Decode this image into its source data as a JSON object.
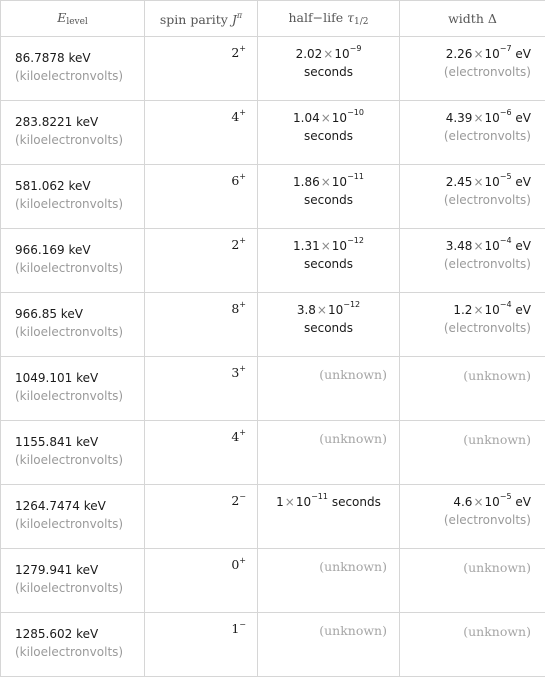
{
  "header": {
    "col1": {
      "symbol": "E",
      "subscript": "level"
    },
    "col2": {
      "label": "spin parity ",
      "symbol": "J",
      "superscript": "π"
    },
    "col3": {
      "label": "half−life ",
      "symbol": "τ",
      "subscript": "1/2"
    },
    "col4": {
      "label": "width Δ"
    }
  },
  "rows": [
    {
      "energy": "86.7878 keV",
      "energy_unit": "(kiloelectronvolts)",
      "spin": "2",
      "parity": "+",
      "halflife": {
        "mantissa": "2.02",
        "exp": "−9",
        "unit": "seconds",
        "inline": false
      },
      "width": {
        "mantissa": "2.26",
        "exp": "−7",
        "unit": "eV",
        "unit_long": "(electronvolts)"
      }
    },
    {
      "energy": "283.8221 keV",
      "energy_unit": "(kiloelectronvolts)",
      "spin": "4",
      "parity": "+",
      "halflife": {
        "mantissa": "1.04",
        "exp": "−10",
        "unit": "seconds",
        "inline": false
      },
      "width": {
        "mantissa": "4.39",
        "exp": "−6",
        "unit": "eV",
        "unit_long": "(electronvolts)"
      }
    },
    {
      "energy": "581.062 keV",
      "energy_unit": "(kiloelectronvolts)",
      "spin": "6",
      "parity": "+",
      "halflife": {
        "mantissa": "1.86",
        "exp": "−11",
        "unit": "seconds",
        "inline": false
      },
      "width": {
        "mantissa": "2.45",
        "exp": "−5",
        "unit": "eV",
        "unit_long": "(electronvolts)"
      }
    },
    {
      "energy": "966.169 keV",
      "energy_unit": "(kiloelectronvolts)",
      "spin": "2",
      "parity": "+",
      "halflife": {
        "mantissa": "1.31",
        "exp": "−12",
        "unit": "seconds",
        "inline": false
      },
      "width": {
        "mantissa": "3.48",
        "exp": "−4",
        "unit": "eV",
        "unit_long": "(electronvolts)"
      }
    },
    {
      "energy": "966.85 keV",
      "energy_unit": "(kiloelectronvolts)",
      "spin": "8",
      "parity": "+",
      "halflife": {
        "mantissa": "3.8",
        "exp": "−12",
        "unit": "seconds",
        "inline": false
      },
      "width": {
        "mantissa": "1.2",
        "exp": "−4",
        "unit": "eV",
        "unit_long": "(electronvolts)"
      }
    },
    {
      "energy": "1049.101 keV",
      "energy_unit": "(kiloelectronvolts)",
      "spin": "3",
      "parity": "+",
      "halflife": null,
      "width": null
    },
    {
      "energy": "1155.841 keV",
      "energy_unit": "(kiloelectronvolts)",
      "spin": "4",
      "parity": "+",
      "halflife": null,
      "width": null
    },
    {
      "energy": "1264.7474 keV",
      "energy_unit": "(kiloelectronvolts)",
      "spin": "2",
      "parity": "−",
      "halflife": {
        "mantissa": "1",
        "exp": "−11",
        "unit": "seconds",
        "inline": true
      },
      "width": {
        "mantissa": "4.6",
        "exp": "−5",
        "unit": "eV",
        "unit_long": "(electronvolts)"
      }
    },
    {
      "energy": "1279.941 keV",
      "energy_unit": "(kiloelectronvolts)",
      "spin": "0",
      "parity": "+",
      "halflife": null,
      "width": null
    },
    {
      "energy": "1285.602 keV",
      "energy_unit": "(kiloelectronvolts)",
      "spin": "1",
      "parity": "−",
      "halflife": null,
      "width": null
    }
  ],
  "unknown_label": "(unknown)",
  "times_symbol": "×",
  "base": "10"
}
